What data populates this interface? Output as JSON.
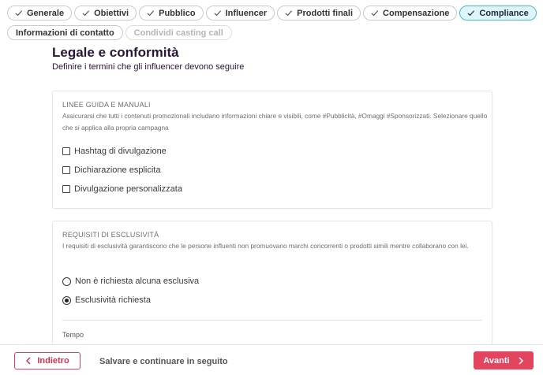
{
  "tabs": [
    {
      "label": "Generale",
      "checked": true
    },
    {
      "label": "Obiettivi",
      "checked": true
    },
    {
      "label": "Pubblico",
      "checked": true
    },
    {
      "label": "Influencer",
      "checked": true
    },
    {
      "label": "Prodotti finali",
      "checked": true
    },
    {
      "label": "Compensazione",
      "checked": true
    },
    {
      "label": "Compliance",
      "checked": true,
      "active": true
    }
  ],
  "tabs_row2": [
    {
      "label": "Informazioni di contatto"
    },
    {
      "label": "Condividi casting call",
      "disabled": true
    }
  ],
  "header": {
    "title": "Legale e conformità",
    "subtitle": "Definire i termini che gli influencer devono seguire"
  },
  "guidelines": {
    "title": "LINEE GUIDA E MANUALI",
    "description": "Assicurarsi che tutti i contenuti promozionali includano informazioni chiare e visibili, come #Pubblicità, #Omaggi #Sponsorizzati. Selezionare quello che si applica alla propria campagna",
    "options": [
      "Hashtag di divulgazione",
      "Dichiarazione esplicita",
      "Divulgazione personalizzata"
    ]
  },
  "exclusivity": {
    "title": "REQUISITI DI ESCLUSIVITÀ",
    "description": "I requisiti di esclusività garantiscono che le persone influenti non promuovano marchi concorrenti o prodotti simili mentre collaborano con lei.",
    "options": [
      "Non è richiesta alcuna esclusiva",
      "Esclusività richiesta"
    ],
    "selected": "Esclusività richiesta",
    "tempo_label": "Tempo"
  },
  "footer": {
    "back_label": "Indietro",
    "save_later_label": "Salvare e continuare in seguito",
    "next_label": "Avanti"
  },
  "colors": {
    "accent_red": "#e3455f",
    "active_tab_bg": "#def5f9",
    "active_tab_border": "#47b8cc",
    "title_color": "#2b1538"
  },
  "icons": [
    "check-icon",
    "chevron-left-icon",
    "chevron-right-icon"
  ]
}
